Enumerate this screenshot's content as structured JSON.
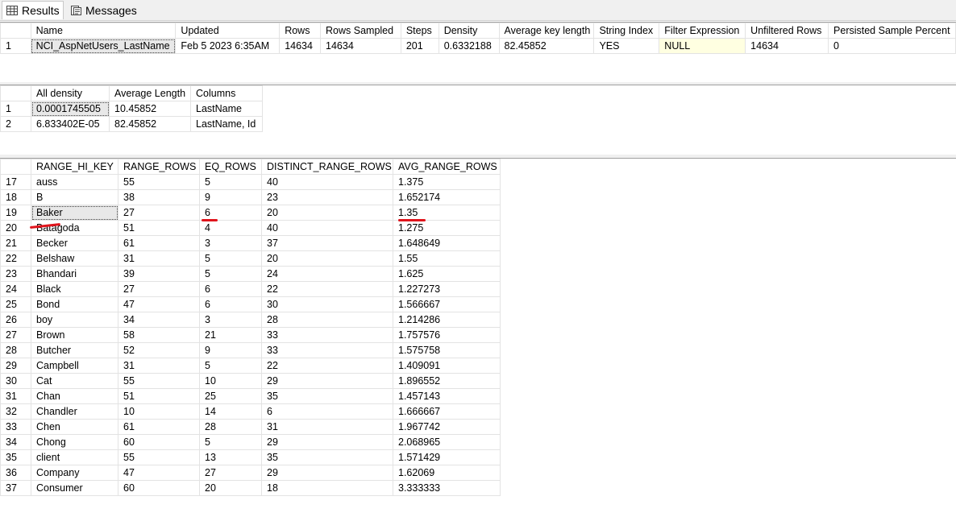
{
  "tabs": {
    "results": "Results",
    "messages": "Messages"
  },
  "stats_header": {
    "columns": [
      "Name",
      "Updated",
      "Rows",
      "Rows Sampled",
      "Steps",
      "Density",
      "Average key length",
      "String Index",
      "Filter Expression",
      "Unfiltered Rows",
      "Persisted Sample Percent"
    ],
    "rows": [
      [
        "1",
        "NCI_AspNetUsers_LastName",
        "Feb  5 2023  6:35AM",
        "14634",
        "14634",
        "201",
        "0.6332188",
        "82.45852",
        "YES",
        "NULL",
        "14634",
        "0"
      ]
    ]
  },
  "density_vector": {
    "columns": [
      "All density",
      "Average Length",
      "Columns"
    ],
    "rows": [
      [
        "1",
        "0.0001745505",
        "10.45852",
        "LastName"
      ],
      [
        "2",
        "6.833402E-05",
        "82.45852",
        "LastName, Id"
      ]
    ]
  },
  "histogram": {
    "columns": [
      "RANGE_HI_KEY",
      "RANGE_ROWS",
      "EQ_ROWS",
      "DISTINCT_RANGE_ROWS",
      "AVG_RANGE_ROWS"
    ],
    "rows": [
      [
        "17",
        "auss",
        "55",
        "5",
        "40",
        "1.375"
      ],
      [
        "18",
        "B",
        "38",
        "9",
        "23",
        "1.652174"
      ],
      [
        "19",
        "Baker",
        "27",
        "6",
        "20",
        "1.35"
      ],
      [
        "20",
        "Batagoda",
        "51",
        "4",
        "40",
        "1.275"
      ],
      [
        "21",
        "Becker",
        "61",
        "3",
        "37",
        "1.648649"
      ],
      [
        "22",
        "Belshaw",
        "31",
        "5",
        "20",
        "1.55"
      ],
      [
        "23",
        "Bhandari",
        "39",
        "5",
        "24",
        "1.625"
      ],
      [
        "24",
        "Black",
        "27",
        "6",
        "22",
        "1.227273"
      ],
      [
        "25",
        "Bond",
        "47",
        "6",
        "30",
        "1.566667"
      ],
      [
        "26",
        "boy",
        "34",
        "3",
        "28",
        "1.214286"
      ],
      [
        "27",
        "Brown",
        "58",
        "21",
        "33",
        "1.757576"
      ],
      [
        "28",
        "Butcher",
        "52",
        "9",
        "33",
        "1.575758"
      ],
      [
        "29",
        "Campbell",
        "31",
        "5",
        "22",
        "1.409091"
      ],
      [
        "30",
        "Cat",
        "55",
        "10",
        "29",
        "1.896552"
      ],
      [
        "31",
        "Chan",
        "51",
        "25",
        "35",
        "1.457143"
      ],
      [
        "32",
        "Chandler",
        "10",
        "14",
        "6",
        "1.666667"
      ],
      [
        "33",
        "Chen",
        "61",
        "28",
        "31",
        "1.967742"
      ],
      [
        "34",
        "Chong",
        "60",
        "5",
        "29",
        "2.068965"
      ],
      [
        "35",
        "client",
        "55",
        "13",
        "35",
        "1.571429"
      ],
      [
        "36",
        "Company",
        "47",
        "27",
        "29",
        "1.62069"
      ],
      [
        "37",
        "Consumer",
        "60",
        "20",
        "18",
        "3.333333"
      ]
    ]
  },
  "colors": {
    "annotation": "#e0141c",
    "null_cell": "#ffffe1",
    "selected_cell": "#e8e8e8"
  },
  "icons": {
    "results": "grid-icon",
    "messages": "messages-icon"
  }
}
